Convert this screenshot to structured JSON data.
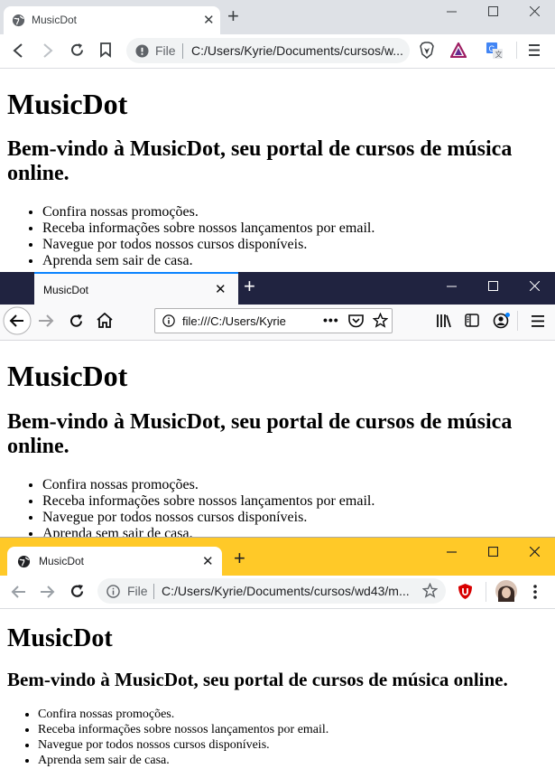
{
  "page": {
    "heading": "MusicDot",
    "subheading": "Bem-vindo à MusicDot, seu portal de cursos de música online.",
    "items": [
      "Confira nossas promoções.",
      "Receba informações sobre nossos lançamentos por email.",
      "Navegue por todos nossos cursos disponíveis.",
      "Aprenda sem sair de casa."
    ]
  },
  "brave": {
    "tab_title": "MusicDot",
    "omnibox_scheme": "File",
    "omnibox_url": "C:/Users/Kyrie/Documents/cursos/w..."
  },
  "firefox": {
    "tab_title": "MusicDot",
    "url": "file:///C:/Users/Kyrie"
  },
  "chrome": {
    "tab_title": "MusicDot",
    "omnibox_scheme": "File",
    "omnibox_url": "C:/Users/Kyrie/Documents/cursos/wd43/m..."
  },
  "colors": {
    "brave_tabstrip": "#dee1e6",
    "firefox_tabstrip": "#202340",
    "firefox_tab_accent": "#0a84ff",
    "chrome_tabstrip": "#ffc928"
  }
}
